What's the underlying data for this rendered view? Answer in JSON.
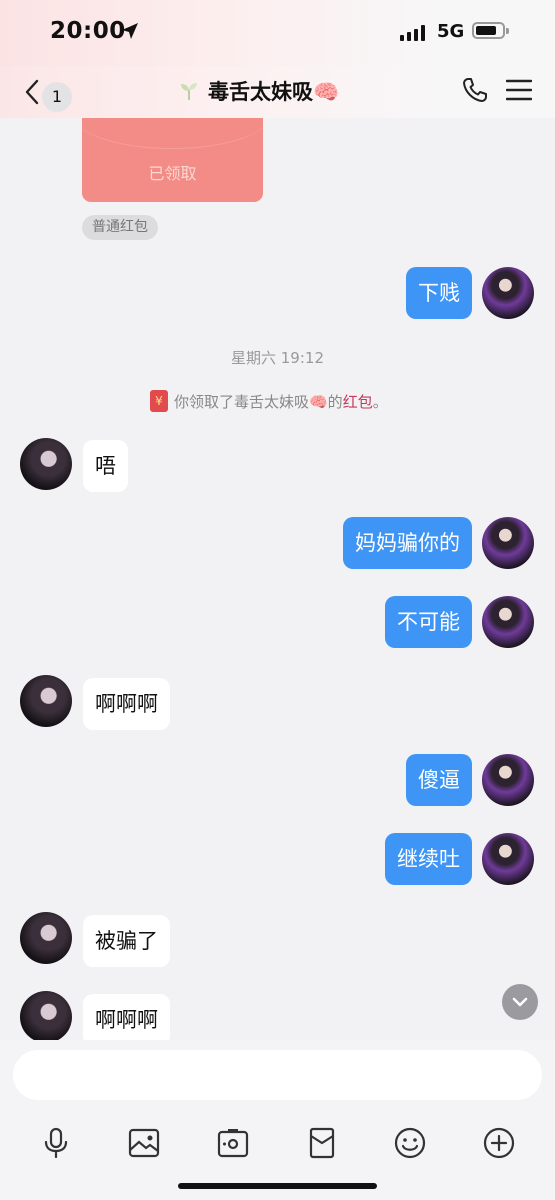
{
  "status_bar": {
    "time": "20:00",
    "network": "5G"
  },
  "nav": {
    "back_count": "1",
    "title": "毒舌太妹吸🧠"
  },
  "red_packet": {
    "status": "已领取",
    "type_label": "普通红包"
  },
  "timestamp": "星期六 19:12",
  "system_note": {
    "prefix": "你领取了毒舌太妹吸🧠的",
    "link": "红包",
    "suffix": "。",
    "icon_text": "¥"
  },
  "messages": [
    {
      "side": "out",
      "text": "下贱"
    },
    {
      "side": "in",
      "text": "唔"
    },
    {
      "side": "out",
      "text": "妈妈骗你的"
    },
    {
      "side": "out",
      "text": "不可能"
    },
    {
      "side": "in",
      "text": "啊啊啊"
    },
    {
      "side": "out",
      "text": "傻逼"
    },
    {
      "side": "out",
      "text": "继续吐"
    },
    {
      "side": "in",
      "text": "被骗了"
    },
    {
      "side": "in",
      "text": "啊啊啊"
    }
  ],
  "input": {
    "placeholder": ""
  },
  "toolbar": [
    "mic-icon",
    "image-icon",
    "camera-icon",
    "red-packet-icon",
    "emoji-icon",
    "plus-icon"
  ],
  "colors": {
    "outgoing_bubble": "#3f95f5",
    "incoming_bubble": "#ffffff",
    "red_packet": "#f38c86"
  }
}
